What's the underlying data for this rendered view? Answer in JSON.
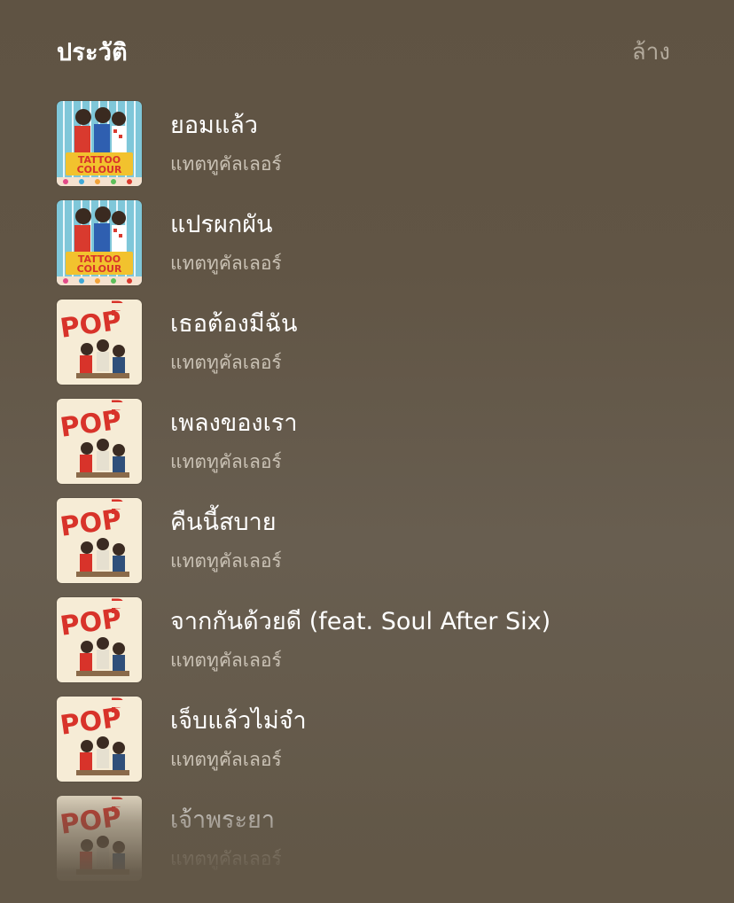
{
  "header": {
    "title": "ประวัติ",
    "clear_label": "ล้าง"
  },
  "items": [
    {
      "song": "ยอมแล้ว",
      "artist": "แทตทูคัลเลอร์",
      "art": "tattoo-colour-cover"
    },
    {
      "song": "แปรผกผัน",
      "artist": "แทตทูคัลเลอร์",
      "art": "tattoo-colour-cover"
    },
    {
      "song": "เธอต้องมีฉัน",
      "artist": "แทตทูคัลเลอร์",
      "art": "pop-pop-cover"
    },
    {
      "song": "เพลงของเรา",
      "artist": "แทตทูคัลเลอร์",
      "art": "pop-pop-cover"
    },
    {
      "song": "คืนนี้สบาย",
      "artist": "แทตทูคัลเลอร์",
      "art": "pop-pop-cover"
    },
    {
      "song": "จากกันด้วยดี (feat. Soul After Six)",
      "artist": "แทตทูคัลเลอร์",
      "art": "pop-pop-cover"
    },
    {
      "song": "เจ็บแล้วไม่จำ",
      "artist": "แทตทูคัลเลอร์",
      "art": "pop-pop-cover"
    },
    {
      "song": "เจ้าพระยา",
      "artist": "แทตทูคัลเลอร์",
      "art": "pop-pop-cover"
    }
  ]
}
